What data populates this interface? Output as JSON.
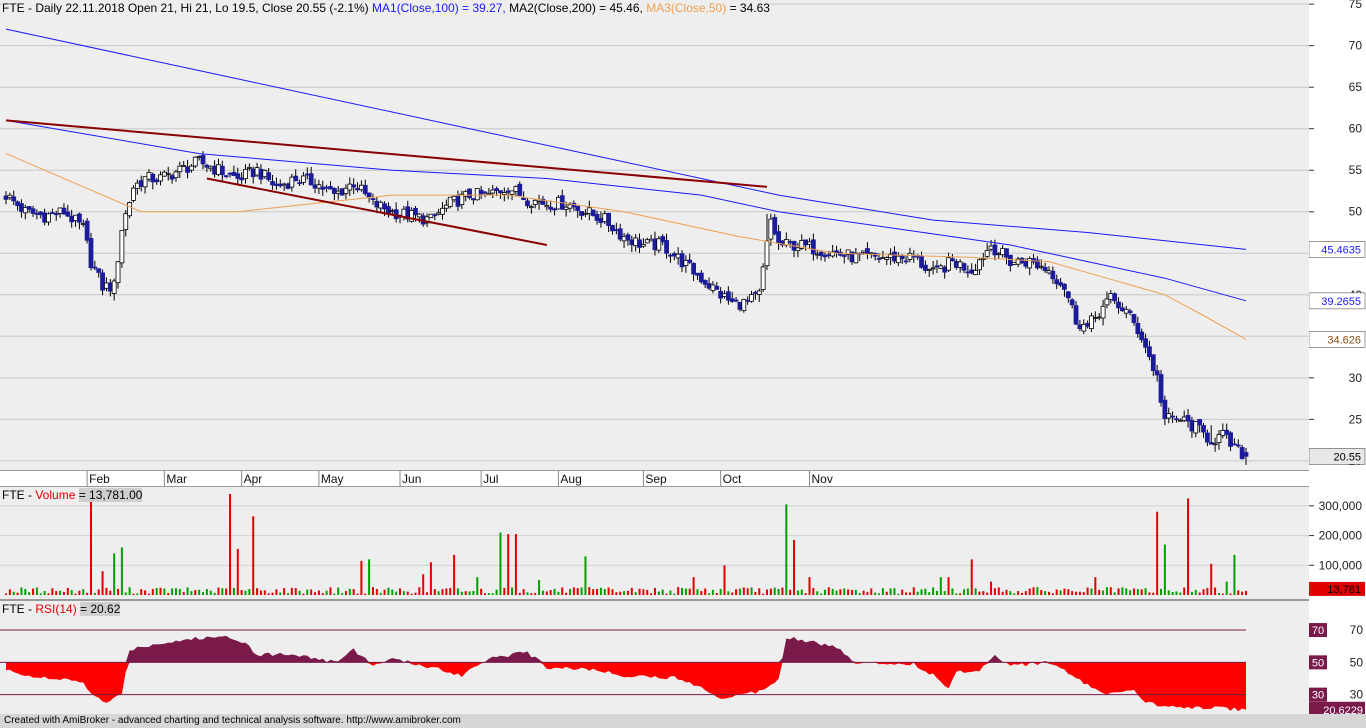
{
  "price_header": {
    "symbol": "FTE",
    "text": "Daily 22.11.2018 Open 21, Hi 21, Lo 19.5, Close 20.55 (-2.1%)",
    "ma1": "MA1(Close,100) = 39.27,",
    "ma2": "MA2(Close,200) = 45.46,",
    "ma3": "MA3(Close,50)",
    "ma3_value": "= 34.63"
  },
  "volume_header": {
    "symbol": "FTE -",
    "label": "Volume",
    "value": "= 13,781.00"
  },
  "rsi_header": {
    "symbol": "FTE -",
    "label": "RSI(14)",
    "value": "= 20.62"
  },
  "footer": "Created with AmiBroker - advanced charting and technical analysis software. http://www.amibroker.com",
  "colors": {
    "pane_bg": "#eeeeee",
    "candle_down": "#1c1c9a",
    "candle_up": "#ffffff",
    "ma1": "#1a1aff",
    "ma2": "#1a1aff",
    "ma3": "#f0a050",
    "trendline": "#8b0000",
    "vol_up": "#00a000",
    "vol_down": "#e00000",
    "rsi_fill_up": "#7a1a4a",
    "rsi_fill_down": "#ff0000"
  },
  "chart_data": [
    {
      "type": "candlestick",
      "title": "FTE - Daily 22.11.2018",
      "y_ticks": [
        20,
        25,
        30,
        35,
        40,
        45,
        50,
        55,
        60,
        65,
        70,
        75
      ],
      "ylim": [
        18.9,
        75.5
      ],
      "months": [
        "Feb",
        "Mar",
        "Apr",
        "May",
        "Jun",
        "Jul",
        "Aug",
        "Sep",
        "Oct",
        "Nov"
      ],
      "price_tags": {
        "ma2": "45.4635",
        "ma1": "39.2655",
        "ma3": "34.626",
        "close": "20.55"
      },
      "anchors": [
        [
          0,
          52
        ],
        [
          5,
          50
        ],
        [
          10,
          49.5
        ],
        [
          15,
          50
        ],
        [
          20,
          48
        ],
        [
          22,
          44
        ],
        [
          25,
          41
        ],
        [
          28,
          41
        ],
        [
          30,
          48
        ],
        [
          33,
          53
        ],
        [
          36,
          54
        ],
        [
          40,
          54
        ],
        [
          45,
          55
        ],
        [
          50,
          56
        ],
        [
          55,
          55
        ],
        [
          60,
          54
        ],
        [
          65,
          55
        ],
        [
          70,
          53
        ],
        [
          75,
          54
        ],
        [
          80,
          53.5
        ],
        [
          85,
          52
        ],
        [
          90,
          53.5
        ],
        [
          95,
          51
        ],
        [
          100,
          50
        ],
        [
          105,
          49.5
        ],
        [
          110,
          49
        ],
        [
          115,
          51
        ],
        [
          120,
          52
        ],
        [
          125,
          52
        ],
        [
          130,
          53
        ],
        [
          135,
          51.5
        ],
        [
          140,
          51
        ],
        [
          145,
          51
        ],
        [
          150,
          50
        ],
        [
          155,
          49
        ],
        [
          160,
          47
        ],
        [
          165,
          46
        ],
        [
          170,
          46
        ],
        [
          175,
          44
        ],
        [
          180,
          42
        ],
        [
          185,
          40
        ],
        [
          188,
          39
        ],
        [
          192,
          39
        ],
        [
          195,
          40
        ],
        [
          197,
          46
        ],
        [
          198,
          49
        ],
        [
          200,
          46
        ],
        [
          205,
          46
        ],
        [
          210,
          45.5
        ],
        [
          215,
          45
        ],
        [
          220,
          44.5
        ],
        [
          225,
          44.5
        ],
        [
          230,
          44.5
        ],
        [
          235,
          44.5
        ],
        [
          240,
          42.5
        ],
        [
          245,
          44
        ],
        [
          250,
          43
        ],
        [
          255,
          46
        ],
        [
          260,
          44
        ],
        [
          265,
          44
        ],
        [
          270,
          43
        ],
        [
          274,
          41
        ],
        [
          277,
          37
        ],
        [
          280,
          36
        ],
        [
          283,
          38
        ],
        [
          286,
          39.5
        ],
        [
          290,
          38
        ],
        [
          294,
          35
        ],
        [
          296,
          32.5
        ],
        [
          298,
          30
        ],
        [
          300,
          25
        ],
        [
          304,
          25
        ],
        [
          308,
          24
        ],
        [
          312,
          22.5
        ],
        [
          315,
          23
        ],
        [
          318,
          21.5
        ],
        [
          321,
          20.55
        ]
      ],
      "ma1_points": [
        [
          0,
          61
        ],
        [
          50,
          57
        ],
        [
          100,
          55
        ],
        [
          140,
          54
        ],
        [
          180,
          52
        ],
        [
          200,
          50
        ],
        [
          230,
          48
        ],
        [
          260,
          46
        ],
        [
          280,
          44
        ],
        [
          300,
          42
        ],
        [
          321,
          39.27
        ]
      ],
      "ma2_points": [
        [
          0,
          72
        ],
        [
          60,
          66
        ],
        [
          120,
          60
        ],
        [
          160,
          56
        ],
        [
          200,
          52
        ],
        [
          240,
          49
        ],
        [
          280,
          47.5
        ],
        [
          321,
          45.46
        ]
      ],
      "ma3_points": [
        [
          0,
          57
        ],
        [
          20,
          53
        ],
        [
          35,
          50
        ],
        [
          60,
          50
        ],
        [
          80,
          51
        ],
        [
          100,
          52
        ],
        [
          130,
          52
        ],
        [
          160,
          50
        ],
        [
          190,
          47
        ],
        [
          215,
          45
        ],
        [
          250,
          44.5
        ],
        [
          270,
          44
        ],
        [
          285,
          42
        ],
        [
          300,
          40
        ],
        [
          310,
          37.5
        ],
        [
          321,
          34.63
        ]
      ],
      "trendlines": [
        {
          "from": [
            0,
            61
          ],
          "to": [
            197,
            53
          ]
        },
        {
          "from": [
            52,
            54
          ],
          "to": [
            140,
            46
          ]
        }
      ]
    },
    {
      "type": "bar",
      "title": "Volume",
      "y_ticks": [
        100000,
        200000,
        300000
      ],
      "ylim": [
        0,
        350000
      ],
      "value_tag": "13,781",
      "spikes": [
        [
          22,
          340000,
          "d"
        ],
        [
          25,
          80000,
          "d"
        ],
        [
          28,
          140000,
          "u"
        ],
        [
          30,
          160000,
          "u"
        ],
        [
          58,
          340000,
          "d"
        ],
        [
          60,
          155000,
          "d"
        ],
        [
          64,
          265000,
          "d"
        ],
        [
          92,
          115000,
          "d"
        ],
        [
          94,
          120000,
          "u"
        ],
        [
          108,
          70000,
          "d"
        ],
        [
          110,
          110000,
          "d"
        ],
        [
          116,
          135000,
          "d"
        ],
        [
          122,
          60000,
          "u"
        ],
        [
          128,
          210000,
          "u"
        ],
        [
          130,
          205000,
          "d"
        ],
        [
          132,
          205000,
          "d"
        ],
        [
          138,
          50000,
          "u"
        ],
        [
          150,
          130000,
          "u"
        ],
        [
          178,
          60000,
          "d"
        ],
        [
          186,
          100000,
          "d"
        ],
        [
          202,
          305000,
          "u"
        ],
        [
          204,
          185000,
          "d"
        ],
        [
          208,
          60000,
          "d"
        ],
        [
          242,
          60000,
          "u"
        ],
        [
          244,
          60000,
          "d"
        ],
        [
          250,
          120000,
          "d"
        ],
        [
          255,
          45000,
          "d"
        ],
        [
          282,
          60000,
          "d"
        ],
        [
          298,
          280000,
          "d"
        ],
        [
          300,
          170000,
          "u"
        ],
        [
          306,
          325000,
          "d"
        ],
        [
          312,
          105000,
          "d"
        ],
        [
          316,
          45000,
          "u"
        ],
        [
          318,
          135000,
          "u"
        ]
      ],
      "base": 14000,
      "last": 13781
    },
    {
      "type": "area",
      "title": "RSI(14)",
      "y_ticks": [
        30,
        50,
        70
      ],
      "levels": [
        70,
        50,
        30
      ],
      "ylim": [
        18,
        88
      ],
      "value_tag": "20.6229",
      "anchors": [
        [
          0,
          45
        ],
        [
          10,
          40
        ],
        [
          20,
          38
        ],
        [
          22,
          30
        ],
        [
          26,
          25
        ],
        [
          30,
          30
        ],
        [
          32,
          58
        ],
        [
          40,
          62
        ],
        [
          50,
          65
        ],
        [
          58,
          66
        ],
        [
          62,
          62
        ],
        [
          65,
          55
        ],
        [
          75,
          55
        ],
        [
          85,
          50
        ],
        [
          90,
          58
        ],
        [
          95,
          48
        ],
        [
          100,
          52
        ],
        [
          110,
          47
        ],
        [
          118,
          42
        ],
        [
          125,
          53
        ],
        [
          135,
          56
        ],
        [
          140,
          47
        ],
        [
          150,
          46
        ],
        [
          160,
          42
        ],
        [
          175,
          40
        ],
        [
          185,
          28
        ],
        [
          195,
          32
        ],
        [
          200,
          40
        ],
        [
          202,
          66
        ],
        [
          210,
          62
        ],
        [
          215,
          59
        ],
        [
          220,
          50
        ],
        [
          235,
          49
        ],
        [
          240,
          42
        ],
        [
          244,
          34
        ],
        [
          246,
          44
        ],
        [
          252,
          45
        ],
        [
          256,
          55
        ],
        [
          260,
          48
        ],
        [
          270,
          50
        ],
        [
          280,
          36
        ],
        [
          285,
          30
        ],
        [
          292,
          32
        ],
        [
          295,
          25
        ],
        [
          300,
          23
        ],
        [
          310,
          22
        ],
        [
          321,
          20.62
        ]
      ]
    }
  ]
}
